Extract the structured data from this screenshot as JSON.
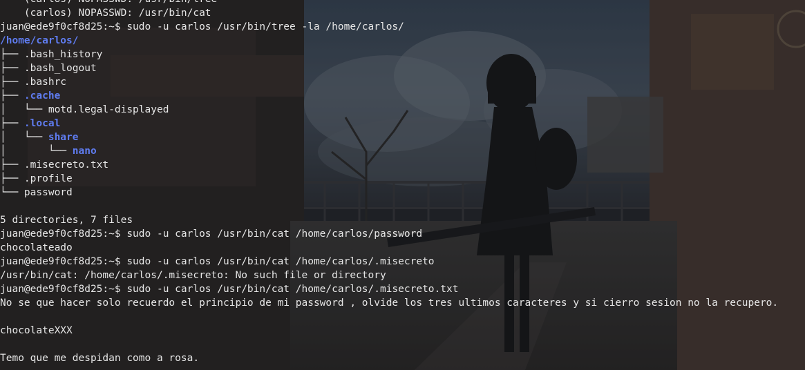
{
  "terminal": {
    "lines": [
      {
        "parts": [
          {
            "t": "    (carlos) NOPASSWD: /usr/bin/tree",
            "c": ""
          }
        ]
      },
      {
        "parts": [
          {
            "t": "    (carlos) NOPASSWD: /usr/bin/cat",
            "c": ""
          }
        ]
      },
      {
        "parts": [
          {
            "t": "juan@ede9f0cf8d25:~$ sudo -u carlos /usr/bin/tree -la /home/carlos/",
            "c": ""
          }
        ]
      },
      {
        "parts": [
          {
            "t": "/home/carlos/",
            "c": "dir"
          }
        ]
      },
      {
        "parts": [
          {
            "t": "├── .bash_history",
            "c": ""
          }
        ]
      },
      {
        "parts": [
          {
            "t": "├── .bash_logout",
            "c": ""
          }
        ]
      },
      {
        "parts": [
          {
            "t": "├── .bashrc",
            "c": ""
          }
        ]
      },
      {
        "parts": [
          {
            "t": "├── ",
            "c": ""
          },
          {
            "t": ".cache",
            "c": "dir"
          }
        ]
      },
      {
        "parts": [
          {
            "t": "│   └── motd.legal-displayed",
            "c": ""
          }
        ]
      },
      {
        "parts": [
          {
            "t": "├── ",
            "c": ""
          },
          {
            "t": ".local",
            "c": "dir"
          }
        ]
      },
      {
        "parts": [
          {
            "t": "│   └── ",
            "c": ""
          },
          {
            "t": "share",
            "c": "dir"
          }
        ]
      },
      {
        "parts": [
          {
            "t": "│       └── ",
            "c": ""
          },
          {
            "t": "nano",
            "c": "dir"
          }
        ]
      },
      {
        "parts": [
          {
            "t": "├── .misecreto.txt",
            "c": ""
          }
        ]
      },
      {
        "parts": [
          {
            "t": "├── .profile",
            "c": ""
          }
        ]
      },
      {
        "parts": [
          {
            "t": "└── password",
            "c": ""
          }
        ]
      },
      {
        "parts": [
          {
            "t": "",
            "c": ""
          }
        ]
      },
      {
        "parts": [
          {
            "t": "5 directories, 7 files",
            "c": ""
          }
        ]
      },
      {
        "parts": [
          {
            "t": "juan@ede9f0cf8d25:~$ sudo -u carlos /usr/bin/cat /home/carlos/password",
            "c": ""
          }
        ]
      },
      {
        "parts": [
          {
            "t": "chocolateado",
            "c": ""
          }
        ]
      },
      {
        "parts": [
          {
            "t": "juan@ede9f0cf8d25:~$ sudo -u carlos /usr/bin/cat /home/carlos/.misecreto",
            "c": ""
          }
        ]
      },
      {
        "parts": [
          {
            "t": "/usr/bin/cat: /home/carlos/.misecreto: No such file or directory",
            "c": ""
          }
        ]
      },
      {
        "parts": [
          {
            "t": "juan@ede9f0cf8d25:~$ sudo -u carlos /usr/bin/cat /home/carlos/.misecreto.txt",
            "c": ""
          }
        ]
      },
      {
        "parts": [
          {
            "t": "No se que hacer solo recuerdo el principio de mi password , olvide los tres ultimos caracteres y si cierro sesion no la recupero.",
            "c": ""
          }
        ]
      },
      {
        "parts": [
          {
            "t": "",
            "c": ""
          }
        ]
      },
      {
        "parts": [
          {
            "t": "chocolateXXX",
            "c": ""
          }
        ]
      },
      {
        "parts": [
          {
            "t": "",
            "c": ""
          }
        ]
      },
      {
        "parts": [
          {
            "t": "Temo que me despidan como a rosa.",
            "c": ""
          }
        ]
      }
    ]
  },
  "colors": {
    "foreground": "#e6e6e6",
    "directory": "#5f7cf0",
    "background": "#1c1f24"
  }
}
